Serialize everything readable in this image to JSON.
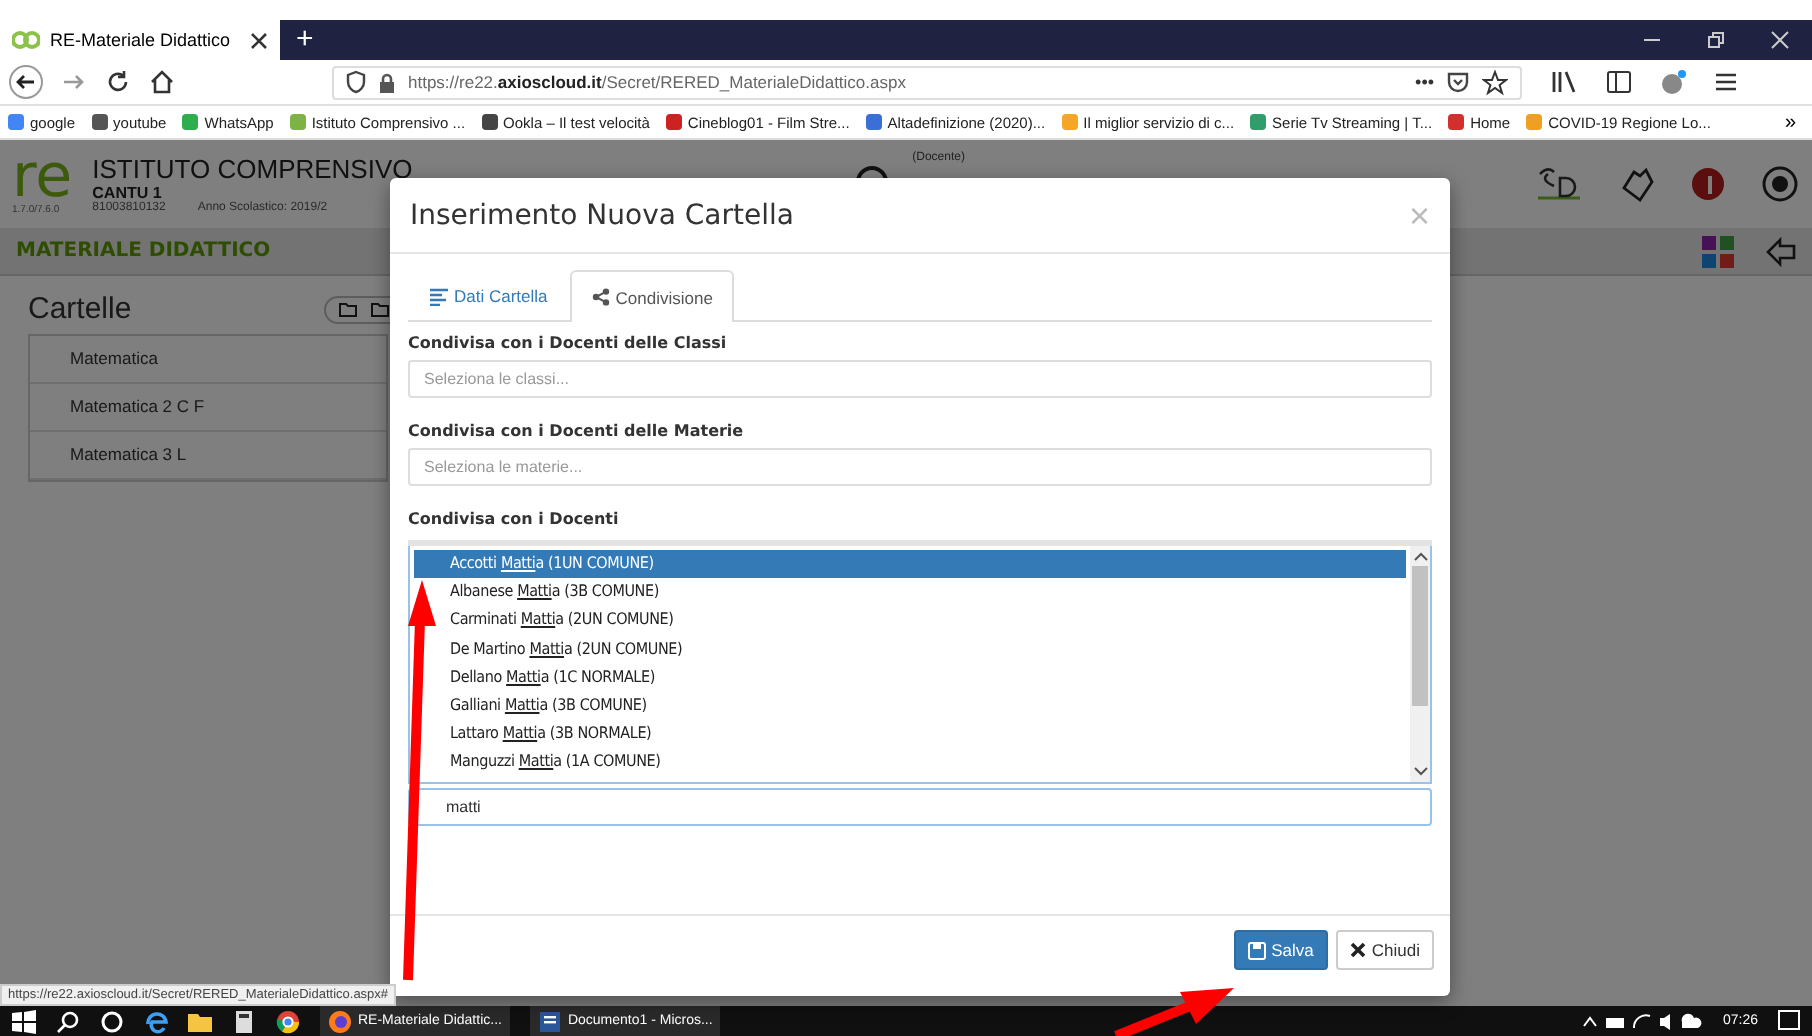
{
  "browser": {
    "tab_title": "RE-Materiale Didattico",
    "new_tab": "+",
    "url": "https://re22.**axioscloud.it**/Secret/RERED_MaterialeDidattico.aspx",
    "page_actions": "•••",
    "bookmarks": [
      {
        "label": "google",
        "color": "#4285f4"
      },
      {
        "label": "youtube",
        "color": "#555555"
      },
      {
        "label": "WhatsApp",
        "color": "#2fae4e"
      },
      {
        "label": "Istituto Comprensivo ...",
        "color": "#7cb342"
      },
      {
        "label": "Ookla – Il test velocità",
        "color": "#444444"
      },
      {
        "label": "Cineblog01 - Film Stre...",
        "color": "#cc2222"
      },
      {
        "label": "Altadefinizione (2020)...",
        "color": "#3a6fd8"
      },
      {
        "label": "Il miglior servizio di c...",
        "color": "#f5a623"
      },
      {
        "label": "Serie Tv Streaming | T...",
        "color": "#2e9e6a"
      },
      {
        "label": "Home",
        "color": "#d32f2f"
      },
      {
        "label": "COVID-19 Regione Lo...",
        "color": "#f0a020"
      }
    ],
    "more": "»"
  },
  "app": {
    "logo": "re",
    "version": "1.7.0/7.6.0",
    "school": "ISTITUTO COMPRENSIVO",
    "school_sub": "CANTU 1",
    "code": "81003810132",
    "year": "Anno Scolastico: 2019/2",
    "role": "(Docente)",
    "section_title": "MATERIALE DIDATTICO",
    "folders_title": "Cartelle",
    "folders": [
      {
        "name": "Matematica"
      },
      {
        "name": "Matematica 2 C F"
      },
      {
        "name": "Matematica 3 L"
      }
    ]
  },
  "modal": {
    "title": "Inserimento Nuova Cartella",
    "close": "×",
    "tabs": [
      {
        "label": "Dati Cartella",
        "selected": false
      },
      {
        "label": "Condivisione",
        "selected": true
      }
    ],
    "fields": [
      {
        "label": "Condivisa con i Docenti delle Classi",
        "placeholder": "Seleziona le classi..."
      },
      {
        "label": "Condivisa con i Docenti delle Materie",
        "placeholder": "Seleziona le materie..."
      }
    ],
    "teachers": {
      "label": "Condivisa con i Docenti",
      "search": "matti",
      "options": [
        {
          "surname": "Accotti",
          "match": "Matti",
          "rest": "a",
          "group": "(1UN COMUNE)",
          "selected": true
        },
        {
          "surname": "Albanese",
          "match": "Matti",
          "rest": "a",
          "group": "(3B COMUNE)",
          "selected": false
        },
        {
          "surname": "Carminati",
          "match": "Matti",
          "rest": "a",
          "group": "(2UN COMUNE)",
          "selected": false
        },
        {
          "surname": "De Martino",
          "match": "Matti",
          "rest": "a",
          "group": "(2UN COMUNE)",
          "selected": false
        },
        {
          "surname": "Dellano",
          "match": "Matti",
          "rest": "a",
          "group": "(1C NORMALE)",
          "selected": false
        },
        {
          "surname": "Galliani",
          "match": "Matti",
          "rest": "a",
          "group": "(3B COMUNE)",
          "selected": false
        },
        {
          "surname": "Lattaro",
          "match": "Matti",
          "rest": "a",
          "group": "(3B NORMALE)",
          "selected": false
        },
        {
          "surname": "Manguzzi",
          "match": "Matti",
          "rest": "a",
          "group": "(1A COMUNE)",
          "selected": false
        }
      ]
    },
    "buttons": [
      {
        "label": "Salva",
        "kind": "primary"
      },
      {
        "label": "Chiudi",
        "kind": "close"
      }
    ]
  },
  "status_url": "https://re22.axioscloud.it/Secret/RERED_MaterialeDidattico.aspx#",
  "taskbar": {
    "items": [
      {
        "label": "RE-Materiale Didattic...",
        "kind": "firefox"
      },
      {
        "label": "Documento1 - Micros...",
        "kind": "word"
      }
    ],
    "time": "07:26"
  }
}
